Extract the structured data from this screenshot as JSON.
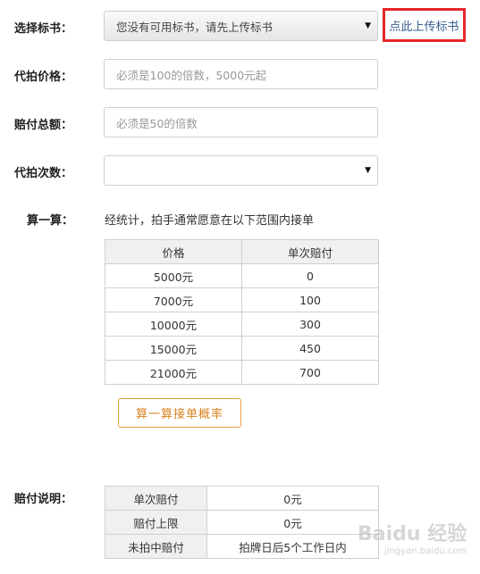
{
  "form": {
    "bid_book": {
      "label": "选择标书：",
      "value": "您没有可用标书，请先上传标书",
      "upload_link": "点此上传标书"
    },
    "proxy_price": {
      "label": "代拍价格：",
      "placeholder": "必须是100的倍数，5000元起"
    },
    "total_compensation": {
      "label": "赔付总额：",
      "placeholder": "必须是50的倍数"
    },
    "proxy_count": {
      "label": "代拍次数：",
      "value": ""
    }
  },
  "calculator": {
    "label": "算一算：",
    "note": "经统计，拍手通常愿意在以下范围内接单",
    "headers": [
      "价格",
      "单次赔付"
    ],
    "rows": [
      [
        "5000元",
        "0"
      ],
      [
        "7000元",
        "100"
      ],
      [
        "10000元",
        "300"
      ],
      [
        "15000元",
        "450"
      ],
      [
        "21000元",
        "700"
      ]
    ],
    "button": "算一算接单概率"
  },
  "compensation_info": {
    "label": "赔付说明：",
    "rows": [
      [
        "单次赔付",
        "0元"
      ],
      [
        "赔付上限",
        "0元"
      ],
      [
        "未拍中赔付",
        "拍牌日后5个工作日内"
      ]
    ]
  },
  "icons": {
    "dropdown_arrow": "▼"
  },
  "watermark": {
    "main": "Baidu 经验",
    "sub": "jingyan.baidu.com"
  },
  "colors": {
    "highlight_border": "#e5262b",
    "link": "#3a5f8f",
    "button_accent": "#d9821e"
  }
}
